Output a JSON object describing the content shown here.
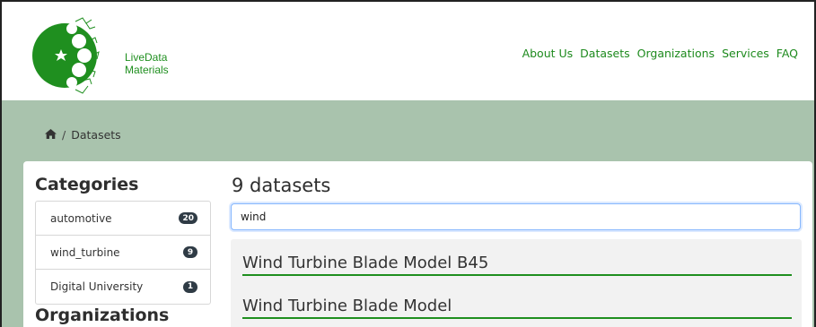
{
  "brand": {
    "line1": "LiveData",
    "line2": "Materials",
    "color": "#1f8f1f"
  },
  "nav": {
    "items": [
      "About Us",
      "Datasets",
      "Organizations",
      "Services",
      "FAQ"
    ]
  },
  "breadcrumb": {
    "home_icon": "home-icon",
    "current": "Datasets",
    "separator": "/"
  },
  "sidebar": {
    "categories_title": "Categories",
    "categories": [
      {
        "label": "automotive",
        "count": "20"
      },
      {
        "label": "wind_turbine",
        "count": "9"
      },
      {
        "label": "Digital University",
        "count": "1"
      }
    ],
    "organizations_title": "Organizations"
  },
  "main": {
    "results_title": "9 datasets",
    "search_value": "wind",
    "results": [
      {
        "title": "Wind Turbine Blade Model B45"
      },
      {
        "title": "Wind Turbine Blade Model"
      }
    ]
  },
  "colors": {
    "accent": "#1f8f1f",
    "band": "#a9c3ad",
    "badge": "#2f3b45"
  }
}
